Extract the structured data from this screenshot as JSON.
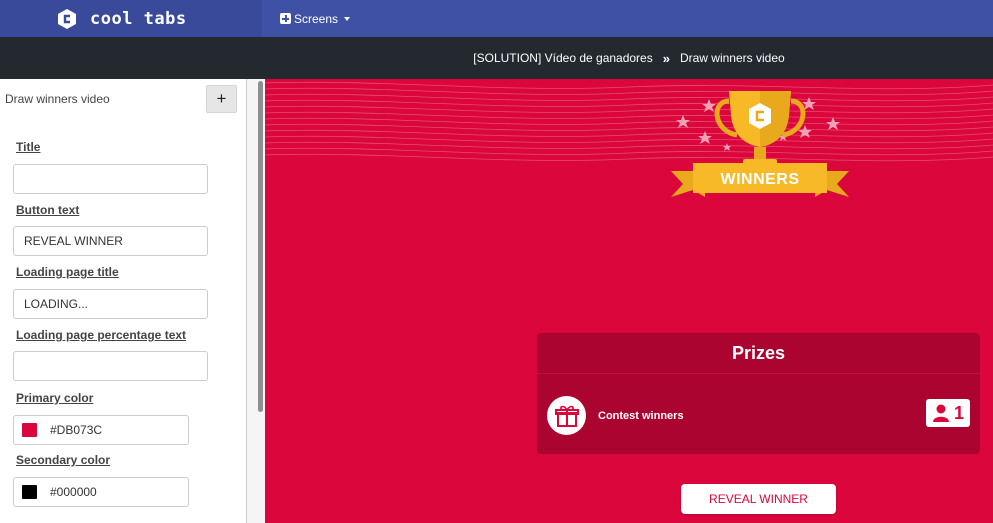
{
  "app": {
    "brand": "cool tabs",
    "screens_menu_label": "Screens"
  },
  "breadcrumb": {
    "parent": "[SOLUTION] Vídeo de ganadores",
    "separator": "»",
    "current": "Draw winners video"
  },
  "sidebar": {
    "title": "Draw winners video",
    "add_label": "+",
    "fields": {
      "title": {
        "label": "Title",
        "value": ""
      },
      "button_text": {
        "label": "Button text",
        "value": "REVEAL WINNER"
      },
      "loading_title": {
        "label": "Loading page title",
        "value": "LOADING..."
      },
      "loading_percentage": {
        "label": "Loading page percentage text",
        "value": ""
      },
      "primary_color": {
        "label": "Primary color",
        "value": "#DB073C"
      },
      "secondary_color": {
        "label": "Secondary color",
        "value": "#000000"
      }
    }
  },
  "preview": {
    "trophy_banner": "WINNERS",
    "prizes_title": "Prizes",
    "prize_name": "Contest winners",
    "winners_count": "1",
    "reveal_button": "REVEAL WINNER",
    "background_color": "#DB073C"
  },
  "icons": {
    "logo": "cooltabs-logo",
    "add": "plus-icon",
    "caret": "caret-down-icon",
    "gift": "gift-icon",
    "user": "user-icon",
    "trophy": "trophy-icon"
  }
}
